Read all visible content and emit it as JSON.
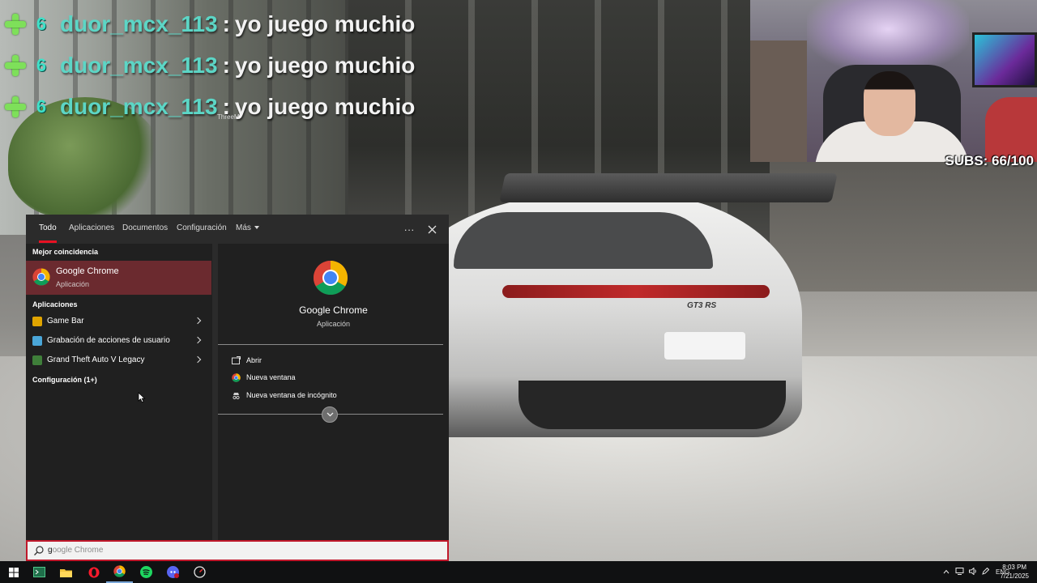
{
  "stream": {
    "chat": [
      {
        "badge_plus": "plus-badge-icon",
        "badge_g": "6",
        "user": "duor_mcx_113",
        "sep": ":",
        "message": "yo juego muchio"
      },
      {
        "badge_plus": "plus-badge-icon",
        "badge_g": "6",
        "user": "duor_mcx_113",
        "sep": ":",
        "message": "yo juego muchio"
      },
      {
        "badge_plus": "plus-badge-icon",
        "badge_g": "6",
        "user": "duor_mcx_113",
        "sep": ":",
        "message": "yo juego muchio"
      }
    ],
    "chat_watermark": "ThreeM",
    "subs_label": "SUBS: 66/100",
    "car_badge": "GT3 RS"
  },
  "search": {
    "tabs": [
      {
        "label": "Todo",
        "active": true
      },
      {
        "label": "Aplicaciones"
      },
      {
        "label": "Documentos"
      },
      {
        "label": "Configuración"
      },
      {
        "label": "Más"
      }
    ],
    "more_icon": "ellipsis-icon",
    "close_icon": "close-icon",
    "best_match_title": "Mejor coincidencia",
    "best_match": {
      "name": "Google Chrome",
      "type": "Aplicación"
    },
    "apps_title": "Aplicaciones",
    "apps": [
      {
        "label": "Game Bar",
        "icon": "game-bar-icon",
        "color": "#e0a400"
      },
      {
        "label": "Grabación de acciones de usuario",
        "icon": "steps-recorder-icon",
        "color": "#4aa6d8"
      },
      {
        "label": "Grand Theft Auto V Legacy",
        "icon": "gta-icon",
        "color": "#3f7f3a"
      }
    ],
    "settings_title": "Configuración (1+)",
    "preview": {
      "name": "Google Chrome",
      "type": "Aplicación"
    },
    "actions": [
      {
        "label": "Abrir",
        "icon": "open-icon"
      },
      {
        "label": "Nueva ventana",
        "icon": "chrome-icon"
      },
      {
        "label": "Nueva ventana de incógnito",
        "icon": "incognito-icon"
      }
    ],
    "query_typed": "g",
    "query_suggest": "oogle Chrome"
  },
  "taskbar": {
    "apps": [
      "windows-start-icon",
      "terminal-icon",
      "file-explorer-icon",
      "opera-icon",
      "chrome-icon",
      "spotify-icon",
      "discord-icon",
      "task-monitor-icon"
    ],
    "language": "ENG",
    "time": "8:03 PM",
    "date": "7/21/2025"
  },
  "colors": {
    "accent_red": "#e81123",
    "best_match_bg": "#6b2a2f",
    "panel_bg": "#202020",
    "chat_user": "#5cd6c6"
  }
}
